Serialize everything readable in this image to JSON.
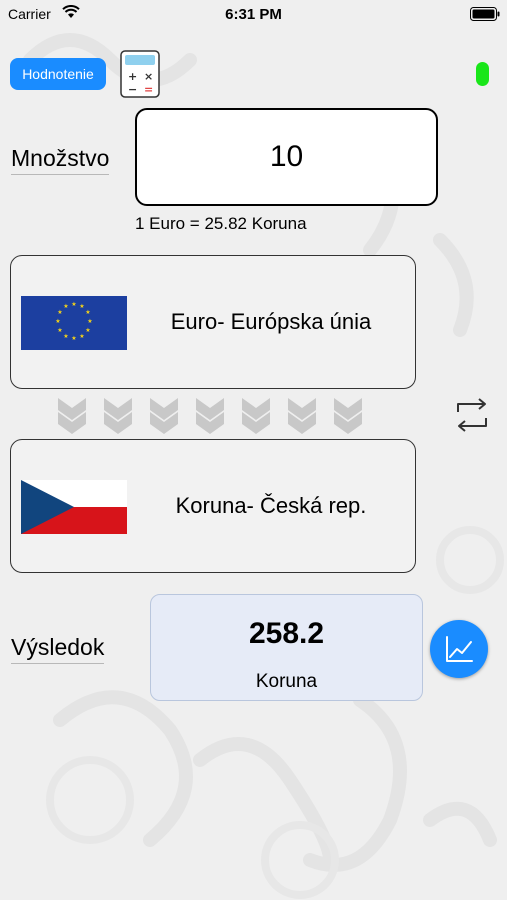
{
  "status_bar": {
    "carrier": "Carrier",
    "time": "6:31 PM"
  },
  "toolbar": {
    "rate_button_label": "Hodnotenie"
  },
  "amount": {
    "label": "Množstvo",
    "value": "10",
    "rate_text": "1 Euro = 25.82 Koruna"
  },
  "from_currency": {
    "name": "Euro- Európska únia",
    "flag_icon": "eu-flag-icon"
  },
  "to_currency": {
    "name": "Koruna- Česká rep.",
    "flag_icon": "czech-flag-icon"
  },
  "result": {
    "label": "Výsledok",
    "value": "258.2",
    "currency": "Koruna"
  },
  "colors": {
    "accent": "#1a8cff",
    "status_dot": "#19e619",
    "result_bg": "#e6ebf7"
  }
}
